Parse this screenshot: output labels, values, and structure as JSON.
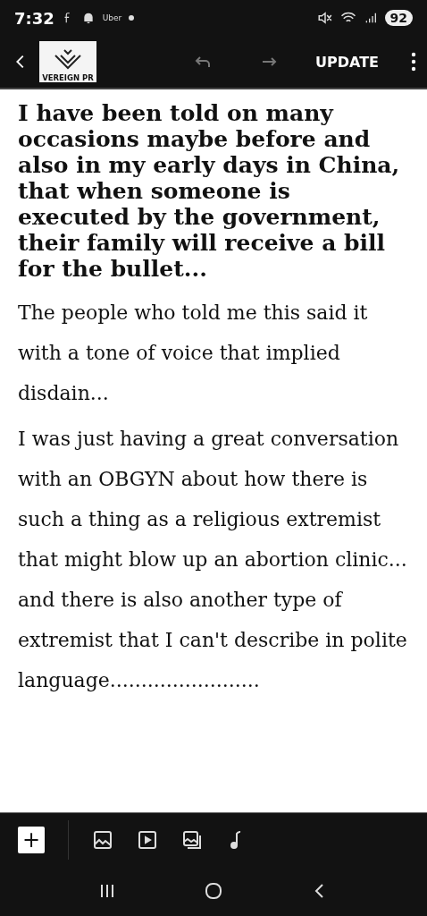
{
  "status_bar": {
    "time": "7:32",
    "notification_app": "Uber",
    "battery": "92"
  },
  "toolbar": {
    "logo_text": "VEREIGN PR",
    "update_button": "UPDATE"
  },
  "post": {
    "heading": "I have been told on many occasions maybe before and also in my early days in China, that when someone is executed by the government, their family will receive a bill for the bullet...",
    "paragraphs": [
      "The people who told me this said it with a tone of voice that implied disdain...",
      "I was just having a great conversation with an OBGYN about how there is such a thing as a religious extremist that might blow up an abortion clinic... and there is also another type of extremist that I can't describe in polite language........................"
    ]
  },
  "insert_bar": {
    "add_button": "+"
  }
}
